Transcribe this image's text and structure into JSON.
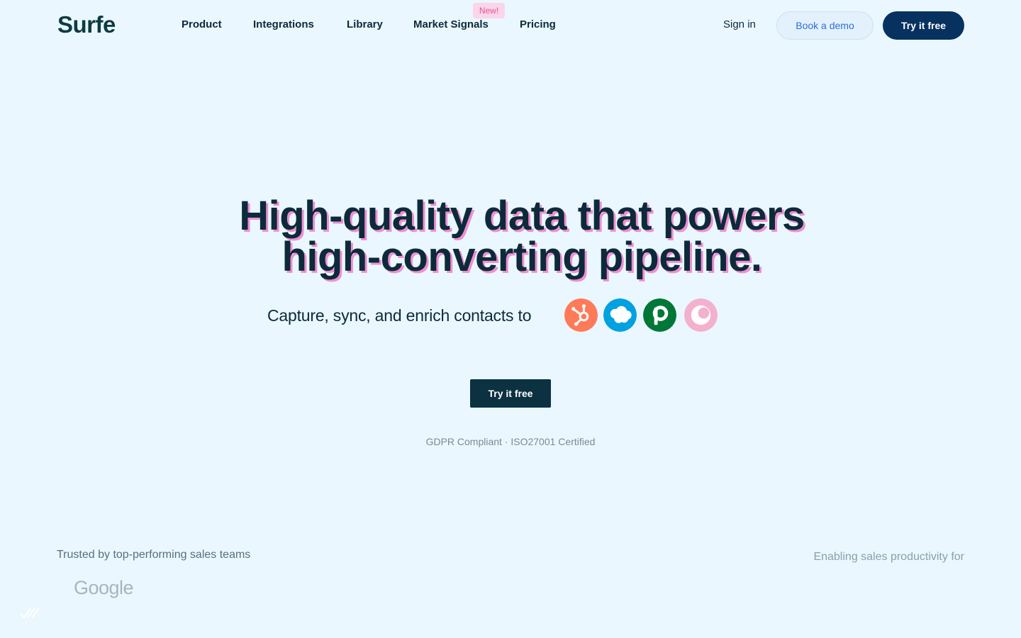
{
  "brand": {
    "logo": "Surfe"
  },
  "nav": {
    "items": [
      "Product",
      "Integrations",
      "Library",
      "Market Signals",
      "Pricing"
    ],
    "badge": "New!",
    "sign_in": "Sign in",
    "book_demo": "Book a demo",
    "try_free": "Try it free"
  },
  "hero": {
    "title_line1": "High-quality data that powers",
    "title_line2": "high-converting pipeline.",
    "subtitle": "Capture, sync, and enrich contacts to",
    "cta": "Try it free",
    "compliance": "GDPR Compliant · ISO27001 Certified",
    "crm_icons": [
      {
        "name": "hubspot-icon",
        "color": "#ff7a59"
      },
      {
        "name": "salesforce-icon",
        "color": "#00a1e0"
      },
      {
        "name": "pipedrive-icon",
        "color": "#017737"
      },
      {
        "name": "copper-icon",
        "color": "#f3b1ce"
      }
    ]
  },
  "footer_strip": {
    "trusted": "Trusted by top-performing sales teams",
    "enabling": "Enabling sales productivity for",
    "logos": [
      "Google"
    ]
  },
  "colors": {
    "background": "#eaf7ff",
    "primary_dark": "#07315f",
    "cta_dark": "#0c3141",
    "title_shadow": "#ee8fd0"
  }
}
